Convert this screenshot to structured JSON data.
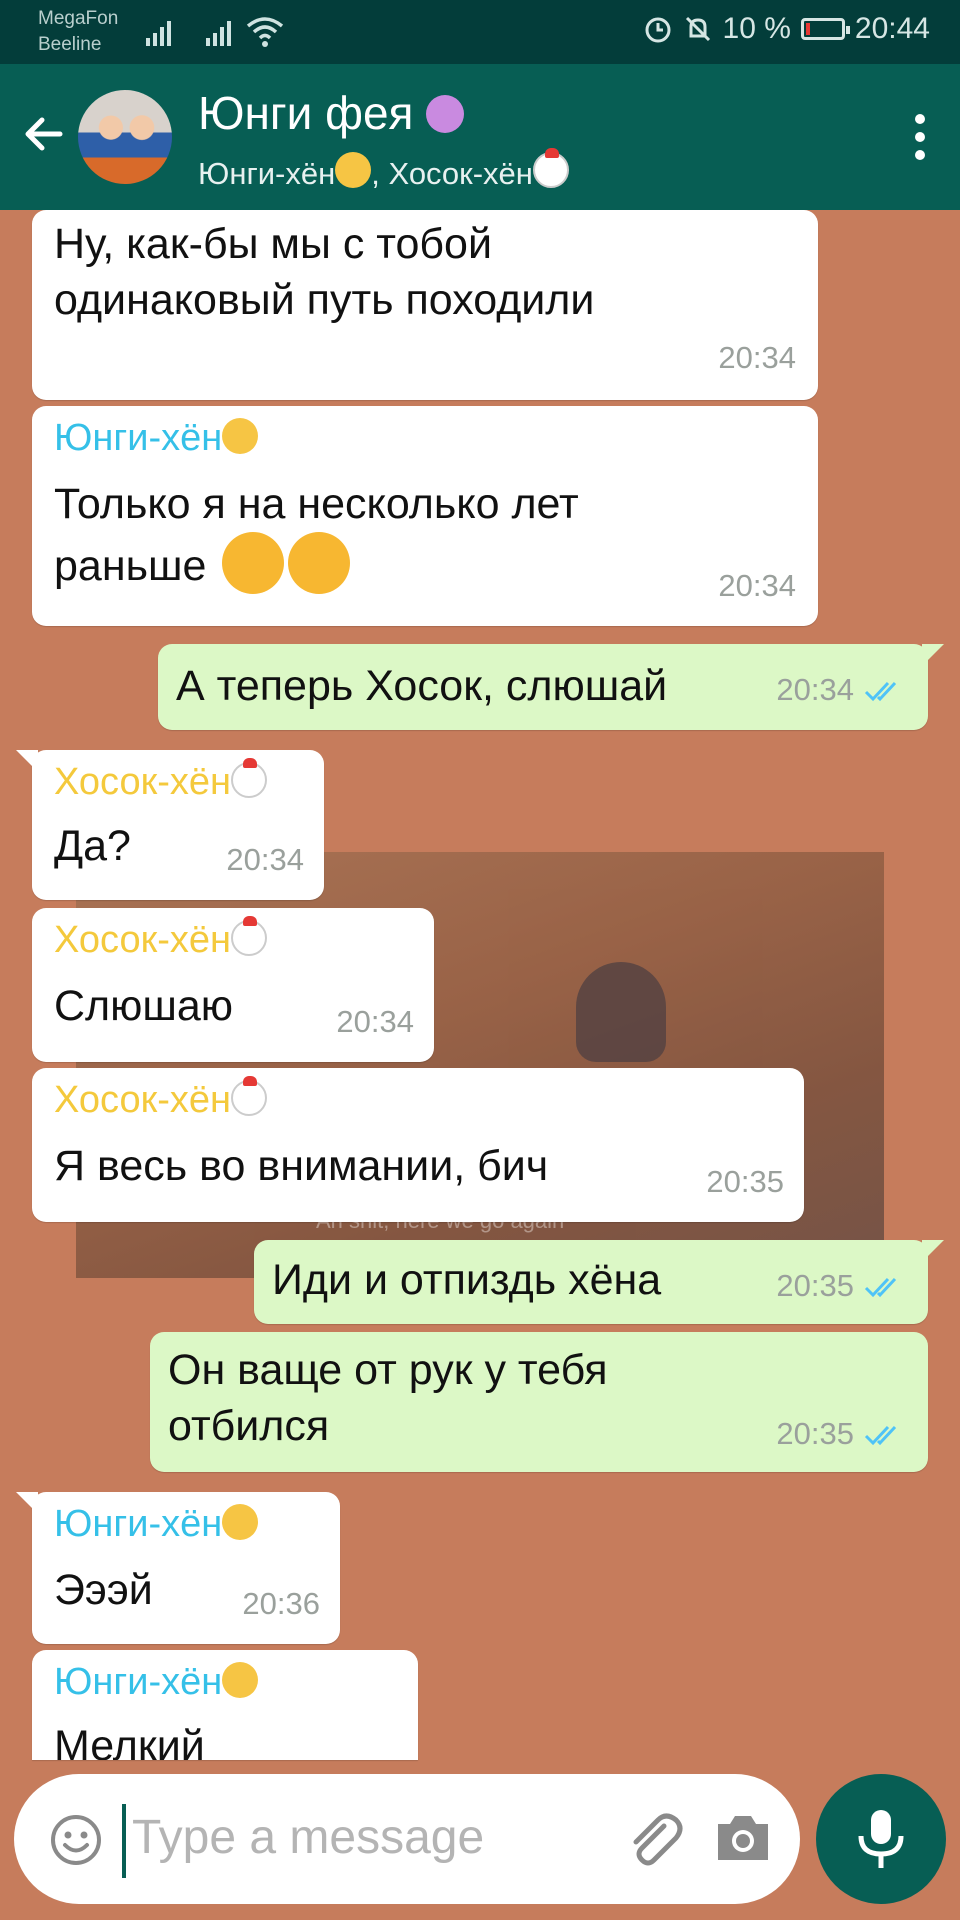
{
  "status_bar": {
    "carrier1": "MegaFon",
    "carrier2": "Beeline",
    "battery": "10 %",
    "battery_level": 0.1,
    "time": "20:44"
  },
  "header": {
    "title": "Юнги фея",
    "subtitle": "Юнги-хён, Хосок-хён",
    "member1": "Юнги-хён",
    "member2": "Хосок-хён"
  },
  "messages": [
    {
      "id": "m1",
      "direction": "in",
      "text": "Ну, как-бы мы с тобой одинаковый путь походили",
      "time": "20:34"
    },
    {
      "id": "m2",
      "direction": "in",
      "sender": "Юнги-хён",
      "text": "Только я на несколько лет раньше",
      "time": "20:34"
    },
    {
      "id": "m3",
      "direction": "out",
      "text": "А теперь Хосок, слюшай",
      "time": "20:34"
    },
    {
      "id": "m4",
      "direction": "in",
      "sender": "Хосок-хён",
      "text": "Да?",
      "time": "20:34"
    },
    {
      "id": "m5",
      "direction": "in",
      "sender": "Хосок-хён",
      "text": "Слюшаю",
      "time": "20:34"
    },
    {
      "id": "m6",
      "direction": "in",
      "sender": "Хосок-хён",
      "text": "Я весь во внимании, бич",
      "time": "20:35"
    },
    {
      "id": "m7",
      "direction": "out",
      "text": "Иди и отпиздь хёна",
      "time": "20:35"
    },
    {
      "id": "m8",
      "direction": "out",
      "text": "Он ваще от рук у тебя отбился",
      "time": "20:35"
    },
    {
      "id": "m9",
      "direction": "in",
      "sender": "Юнги-хён",
      "text": "Эээй",
      "time": "20:36"
    },
    {
      "id": "m10",
      "direction": "in",
      "sender": "Юнги-хён",
      "text": "Мелкий"
    }
  ],
  "wallpaper_caption": "Ah shit, here we go again",
  "input": {
    "placeholder": "Type a message"
  },
  "colors": {
    "header": "#075e54",
    "status_bar": "#033d3a",
    "wallpaper": "#c67c5c",
    "incoming": "#ffffff",
    "outgoing": "#dcf8c6",
    "yoongi_name": "#35c0e8",
    "hoseok_name": "#f4c93c",
    "read_ticks": "#4fc3f7"
  },
  "icons": [
    "back-arrow-icon",
    "more-options-icon",
    "emoji-icon",
    "attach-icon",
    "camera-icon",
    "mic-icon",
    "read-receipt-icon"
  ]
}
